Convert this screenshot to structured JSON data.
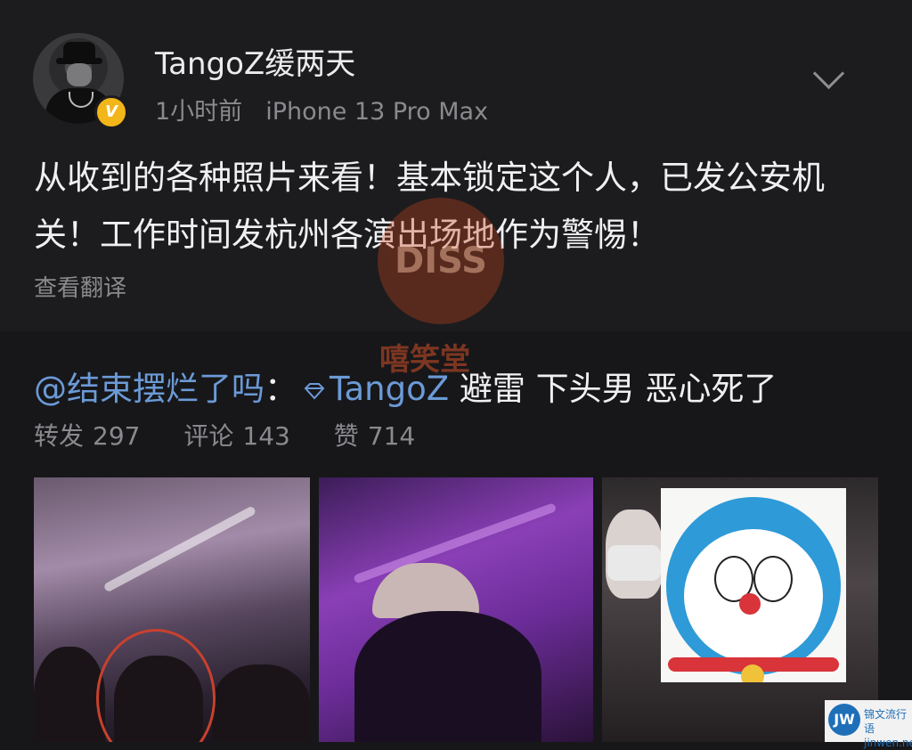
{
  "post": {
    "username": "TangoZ缓两天",
    "verified_badge": "V",
    "time": "1小时前",
    "device": "iPhone 13 Pro Max",
    "content": "从收到的各种照片来看！基本锁定这个人，已发公安机关！工作时间发杭州各演出场地作为警惕！",
    "translate": "查看翻译"
  },
  "retweet": {
    "mention_user": "@结束摆烂了吗",
    "colon": "：",
    "mention_target": "TangoZ",
    "text": " 避雷 下头男 恶心死了",
    "stats": [
      {
        "label": "转发",
        "count": "297"
      },
      {
        "label": "评论",
        "count": "143"
      },
      {
        "label": "赞",
        "count": "714"
      }
    ]
  },
  "watermark": {
    "badge": "DISS",
    "text": "嘻笑堂"
  },
  "corner_logo": {
    "mark": "JW",
    "line1": "锦文流行语",
    "line2": "jinwen.net"
  },
  "colors": {
    "mention": "#6b9ad6",
    "badge": "#f3b619",
    "circle": "#c8412e"
  },
  "icons": [
    "chevron-down-icon",
    "diamond-icon",
    "verified-badge-icon"
  ]
}
